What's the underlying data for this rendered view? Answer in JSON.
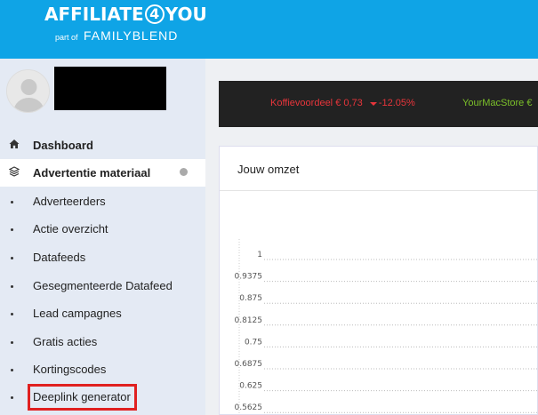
{
  "header": {
    "logo_left": "AFFILIATE",
    "logo_number": "4",
    "logo_right": "YOU",
    "logo_part_of": "part of",
    "logo_brand": "FAMILYBLEND",
    "background_color": "#0fa4e6"
  },
  "sidebar": {
    "items": [
      {
        "label": "Dashboard",
        "icon": "home-icon"
      },
      {
        "label": "Advertentie materiaal",
        "icon": "layers-icon"
      },
      {
        "label": "Adverteerders"
      },
      {
        "label": "Actie overzicht"
      },
      {
        "label": "Datafeeds"
      },
      {
        "label": "Gesegmenteerde Datafeed"
      },
      {
        "label": "Lead campagnes"
      },
      {
        "label": "Gratis acties"
      },
      {
        "label": "Kortingscodes"
      },
      {
        "label": "Deeplink generator"
      }
    ]
  },
  "ticker": {
    "item1_name": "Koffievoordeel",
    "item1_value": "€ 0,73",
    "item1_change": "-12.05%",
    "item2_name": "YourMacStore",
    "item2_value": "€",
    "down_color": "#e8353b",
    "up_color": "#7cc12a"
  },
  "panel": {
    "title": "Jouw omzet"
  },
  "chart_data": {
    "type": "line",
    "title": "",
    "xlabel": "",
    "ylabel": "",
    "y_ticks": [
      "1",
      "0.9375",
      "0.875",
      "0.8125",
      "0.75",
      "0.6875",
      "0.625",
      "0.5625"
    ],
    "series": [],
    "grid": true
  }
}
